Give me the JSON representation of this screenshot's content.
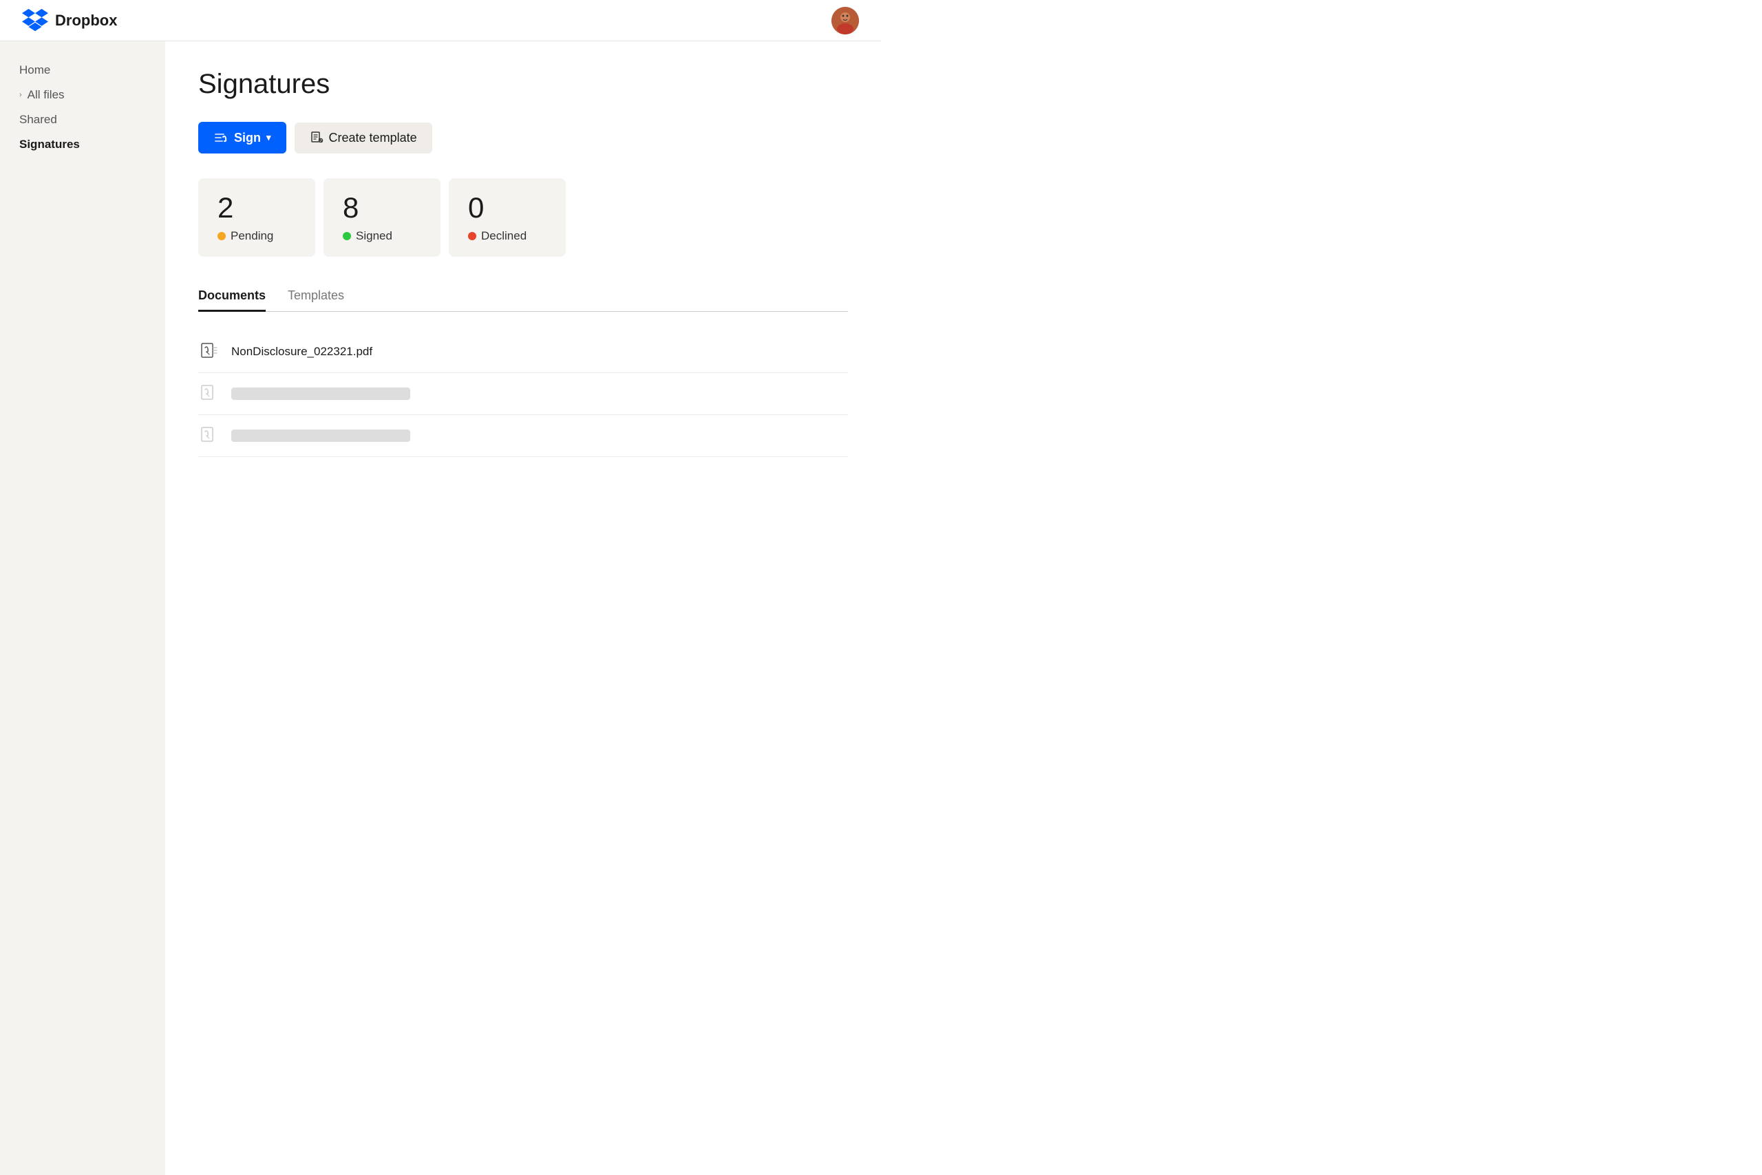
{
  "topbar": {
    "brand": "Dropbox",
    "avatar_label": "User avatar"
  },
  "sidebar": {
    "items": [
      {
        "id": "home",
        "label": "Home",
        "active": false,
        "has_chevron": false
      },
      {
        "id": "all-files",
        "label": "All files",
        "active": false,
        "has_chevron": true
      },
      {
        "id": "shared",
        "label": "Shared",
        "active": false,
        "has_chevron": false
      },
      {
        "id": "signatures",
        "label": "Signatures",
        "active": true,
        "has_chevron": false
      }
    ]
  },
  "main": {
    "page_title": "Signatures",
    "actions": {
      "sign_label": "Sign",
      "sign_chevron": "▾",
      "create_template_label": "Create template"
    },
    "stats": [
      {
        "id": "pending",
        "count": "2",
        "label": "Pending",
        "dot_class": "dot-yellow"
      },
      {
        "id": "signed",
        "count": "8",
        "label": "Signed",
        "dot_class": "dot-green"
      },
      {
        "id": "declined",
        "count": "0",
        "label": "Declined",
        "dot_class": "dot-red"
      }
    ],
    "tabs": [
      {
        "id": "documents",
        "label": "Documents",
        "active": true
      },
      {
        "id": "templates",
        "label": "Templates",
        "active": false
      }
    ],
    "documents": [
      {
        "id": "doc1",
        "name": "NonDisclosure_022321.pdf",
        "skeleton": false
      },
      {
        "id": "doc2",
        "name": "",
        "skeleton": true
      },
      {
        "id": "doc3",
        "name": "",
        "skeleton": true
      }
    ]
  }
}
